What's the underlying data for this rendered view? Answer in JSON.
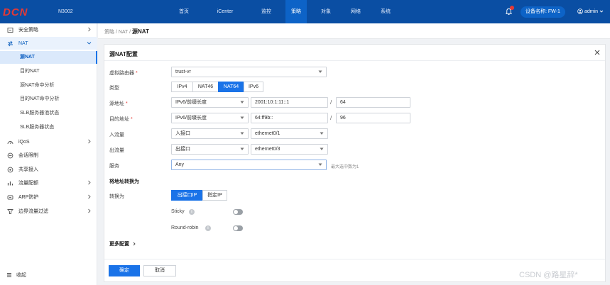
{
  "header": {
    "brand": "DCN",
    "model": "N3002",
    "nav": [
      {
        "label": "首页",
        "width": 30
      },
      {
        "label": "iCenter",
        "width": 62
      },
      {
        "label": "监控",
        "width": 30
      },
      {
        "label": "策略",
        "width": 30
      },
      {
        "label": "对象",
        "width": 30
      },
      {
        "label": "网络",
        "width": 30
      },
      {
        "label": "系统",
        "width": 30
      }
    ],
    "device_label": "设备名称: FW-1",
    "user": "admin"
  },
  "sidebar": {
    "items": [
      {
        "label": "安全策略",
        "icon": "security-policy-icon"
      },
      {
        "label": "NAT",
        "icon": "nat-icon"
      },
      {
        "label": "iQoS",
        "icon": "iqos-icon"
      },
      {
        "label": "会话限制",
        "icon": "session-limit-icon"
      },
      {
        "label": "共享接入",
        "icon": "shared-access-icon"
      },
      {
        "label": "流量配额",
        "icon": "traffic-quota-icon"
      },
      {
        "label": "ARP防护",
        "icon": "arp-protection-icon"
      },
      {
        "label": "边界流量过滤",
        "icon": "boundary-filter-icon"
      }
    ],
    "nat_sub": [
      "源NAT",
      "目的NAT",
      "源NAT命中分析",
      "目的NAT命中分析",
      "SLB服务器池状态",
      "SLB服务器状态"
    ],
    "collapse_label": "收起"
  },
  "breadcrumb": {
    "trail": "策略 / NAT / ",
    "current": "源NAT"
  },
  "panel": {
    "title": "源NAT配置",
    "fields": {
      "vrouter_label": "虚拟路由器",
      "vrouter_value": "trust-vr",
      "type_label": "类型",
      "type_options": [
        "IPv4",
        "NAT46",
        "NAT64",
        "IPv6"
      ],
      "src_label": "源地址",
      "src_mode": "IPv6/前缀长度",
      "src_ip": "2001:10:1:11::1",
      "src_prefix": "64",
      "dst_label": "目的地址",
      "dst_mode": "IPv6/前缀长度",
      "dst_ip": "64:ff9b::",
      "dst_prefix": "96",
      "in_label": "入流量",
      "in_mode": "入接口",
      "in_iface": "ethernet0/1",
      "out_label": "出流量",
      "out_mode": "出接口",
      "out_iface": "ethernet0/3",
      "service_label": "服务",
      "service_value": "Any",
      "service_hint": "最大选中数为1"
    },
    "translation": {
      "section_title": "将地址转换为",
      "convert_label": "转换为",
      "options": [
        "出接口IP",
        "指定IP"
      ],
      "sticky_label": "Sticky",
      "round_robin_label": "Round-robin"
    },
    "more_config": "更多配置",
    "ok_label": "确定",
    "cancel_label": "取消"
  },
  "watermark": "CSDN @路星辞*",
  "colors": {
    "header_bg": "#0a4ea3",
    "accent": "#1a73e8",
    "active_nav": "#0d63c7"
  }
}
